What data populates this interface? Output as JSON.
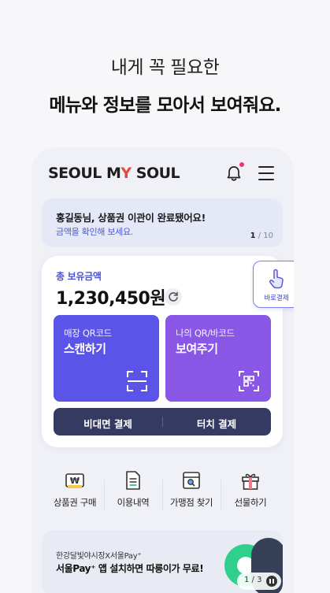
{
  "headline": {
    "line1": "내게 꼭 필요한",
    "line2": "메뉴와 정보를 모아서 보여줘요."
  },
  "topbar": {
    "logo_part1": "SEOUL M",
    "logo_dot": "Y",
    "logo_part2": " SOUL",
    "icons": [
      "bell-icon",
      "hamburger-menu-icon"
    ]
  },
  "notice": {
    "title": "홍길동님, 상품권 이관이 완료됐어요!",
    "subtitle": "금액을 확인해 보세요.",
    "page_current": "1",
    "page_total": " / 10"
  },
  "balance": {
    "label": "총 보유금액",
    "amount": "1,230,450원"
  },
  "quick_pay": {
    "label": "바로결제"
  },
  "tiles": {
    "scan": {
      "line1": "매장 QR코드",
      "line2": "스캔하기"
    },
    "show": {
      "line1": "나의 QR/바코드",
      "line2": "보여주기"
    }
  },
  "paybar": {
    "left": "비대면 결제",
    "right": "터치 결제"
  },
  "menus": [
    {
      "label": "상품권 구매",
      "icon": "voucher-icon"
    },
    {
      "label": "이용내역",
      "icon": "document-icon"
    },
    {
      "label": "가맹점 찾기",
      "icon": "store-icon"
    },
    {
      "label": "선물하기",
      "icon": "gift-icon"
    }
  ],
  "banner": {
    "line1": "한강달빛야시장X서울Pay⁺",
    "line2": "서울Pay⁺ 앱 설치하면 따릉이가 무료!",
    "page": "1 / 3"
  },
  "colors": {
    "accent": "#5a55e8",
    "accent2": "#8a56e6",
    "navy": "#353a63",
    "notice_bg": "#e5e8f7"
  }
}
